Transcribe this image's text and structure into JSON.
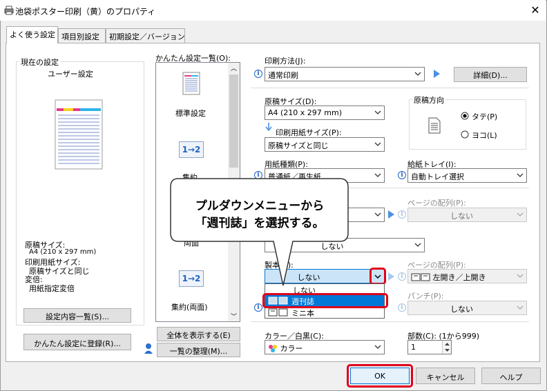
{
  "window": {
    "title": "池袋ポスター印刷（黄）のプロパティ",
    "close": "✕"
  },
  "tabs": [
    {
      "label": "よく使う設定",
      "active": true
    },
    {
      "label": "項目別設定",
      "active": false
    },
    {
      "label": "初期設定／バージョン",
      "active": false
    }
  ],
  "current": {
    "group_label": "現在の設定",
    "user_label": "ユーザー設定",
    "summary": [
      "原稿サイズ:",
      "A4 (210 x 297 mm)",
      "印刷用紙サイズ:",
      "原稿サイズと同じ",
      "変倍:",
      "用紙指定変倍"
    ],
    "list_button": "設定内容一覧(S)...",
    "register_button": "かんたん設定に登録(R)..."
  },
  "preset": {
    "label": "かんたん設定一覧(O):",
    "items": [
      "標準設定",
      "集約",
      "両面",
      "集約(両面)"
    ],
    "icon_text": "1→2",
    "show_all_button": "全体を表示する(E)",
    "organize_button": "一覧の整理(M)..."
  },
  "settings": {
    "print_method_label": "印刷方法(J):",
    "print_method_value": "通常印刷",
    "detail_button": "詳細(D)...",
    "orig_size_label": "原稿サイズ(D):",
    "orig_size_value": "A4 (210 x 297 mm)",
    "paper_size_label": "印刷用紙サイズ(P):",
    "paper_size_value": "原稿サイズと同じ",
    "direction_label": "原稿方向",
    "portrait": "タテ(P)",
    "landscape": "ヨコ(L)",
    "paper_type_label": "用紙種類(P):",
    "paper_type_value": "普通紙／再生紙",
    "tray_label": "給紙トレイ(I):",
    "tray_value": "自動トレイ選択",
    "page_order_label1": "ページの配列(P):",
    "page_order_value1": "しない",
    "middle_value": "しない",
    "binding_label": "製本(B):",
    "binding_value": "しない",
    "page_order_label2": "ページの配列(P):",
    "page_order_value2": "左開き／上開き",
    "punch_label": "パンチ(P):",
    "punch_value": "しない",
    "color_label": "カラー／白黒(C):",
    "color_value": "カラー",
    "copies_label": "部数(C): (1から999)",
    "copies_value": "1"
  },
  "dropdown": {
    "options": [
      "しない",
      "週刊誌",
      "ミニ本"
    ],
    "selected": "週刊誌"
  },
  "callout": {
    "line1": "プルダウンメニューから",
    "line2": "「週刊誌」を選択する。"
  },
  "footer": {
    "ok": "OK",
    "cancel": "キャンセル",
    "help": "ヘルプ"
  },
  "colors": {
    "accent": "#0078d7",
    "highlight_red": "#e0001a",
    "selection_blue": "#0078d7"
  }
}
